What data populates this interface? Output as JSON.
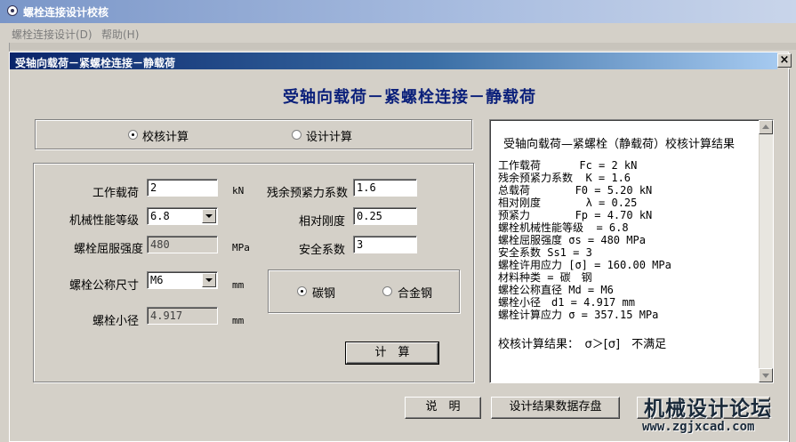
{
  "app": {
    "title": "螺栓连接设计校核",
    "menu": [
      "螺栓连接设计(D)",
      "帮助(H)"
    ]
  },
  "dialog": {
    "title": "受轴向载荷－紧螺栓连接－静载荷",
    "close_label": "×",
    "heading": "受轴向载荷－紧螺栓连接－静载荷"
  },
  "mode": {
    "check_label": "校核计算",
    "design_label": "设计计算",
    "selected": "check"
  },
  "params": {
    "work_load": {
      "label": "工作载荷",
      "value": "2",
      "unit": "kN"
    },
    "grade": {
      "label": "机械性能等级",
      "value": "6.8"
    },
    "yield": {
      "label": "螺栓屈服强度",
      "value": "480",
      "unit": "MPa"
    },
    "nominal": {
      "label": "螺栓公称尺寸",
      "value": "M6",
      "unit": "mm"
    },
    "minor": {
      "label": "螺栓小径",
      "value": "4.917",
      "unit": "mm"
    },
    "residual": {
      "label": "残余预紧力系数",
      "value": "1.6"
    },
    "stiffness": {
      "label": "相对刚度",
      "value": "0.25"
    },
    "safety": {
      "label": "安全系数",
      "value": "3"
    }
  },
  "material": {
    "carbon_label": "碳钢",
    "alloy_label": "合金钢",
    "selected": "carbon"
  },
  "buttons": {
    "calc": "计　算",
    "explain": "说　明",
    "save": "设计结果数据存盘"
  },
  "result": {
    "title": "受轴向载荷—紧螺栓（静载荷）校核计算结果",
    "lines": [
      "工作载荷      Fc = 2 kN",
      "残余预紧力系数  K = 1.6",
      "总载荷       F0 = 5.20 kN",
      "相对刚度       λ = 0.25",
      "预紧力       Fp = 4.70 kN",
      "螺栓机械性能等级  = 6.8",
      "螺栓屈服强度 σs = 480 MPa",
      "安全系数 Ss1 = 3",
      "螺栓许用应力 [σ] = 160.00 MPa",
      "材料种类 = 碳　钢",
      "螺栓公称直径 Md = M6",
      "螺栓小径　d1 = 4.917 mm",
      "螺栓计算应力 σ = 357.15 MPa"
    ],
    "conclusion": "校核计算结果：　σ＞[σ]　不满足"
  },
  "watermark": {
    "cn": "机械设计论坛",
    "url": "www.zgjxcad.com"
  }
}
